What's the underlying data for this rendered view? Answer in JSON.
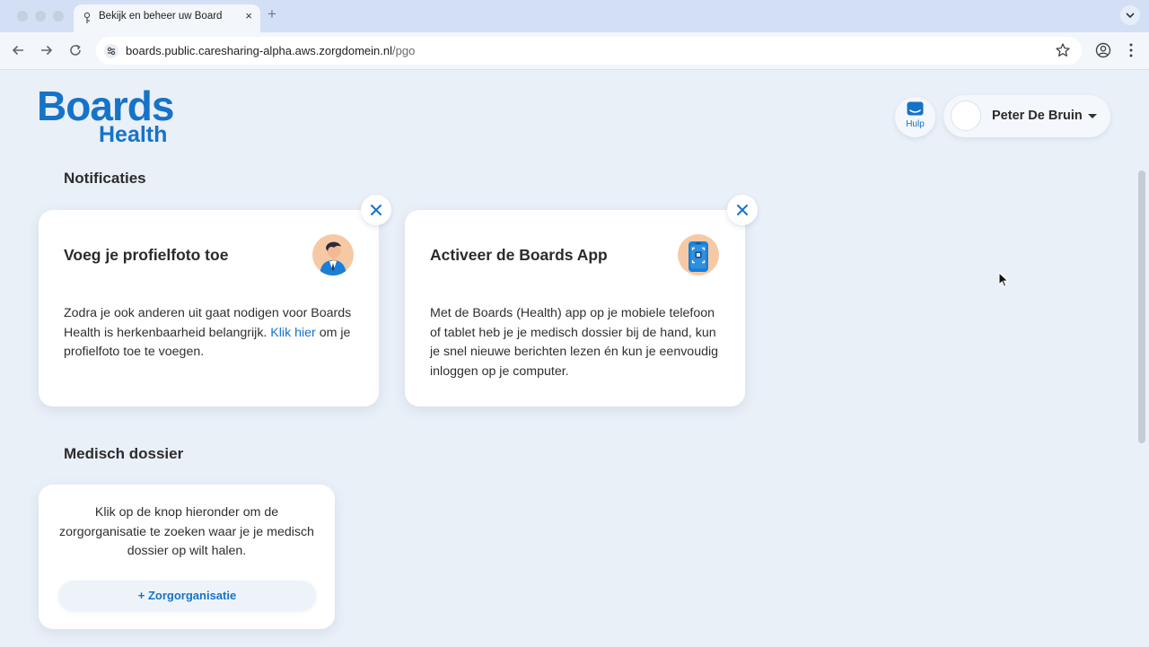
{
  "browser": {
    "tab_title": "Bekijk en beheer uw Boards",
    "tab_close": "×",
    "new_tab": "+",
    "url_host": "boards.public.caresharing-alpha.aws.zorgdomein.nl",
    "url_path": "/pgo"
  },
  "header": {
    "logo_line1": "Boards",
    "logo_line2": "Health",
    "help_label": "Hulp",
    "user_name": "Peter De Bruin"
  },
  "notifications": {
    "title": "Notificaties",
    "cards": [
      {
        "title": "Voeg je profielfoto toe",
        "text_before": "Zodra je ook anderen uit gaat nodigen voor Boards Health is herkenbaarheid belangrijk. ",
        "link": "Klik hier",
        "text_after": " om je profielfoto toe te voegen.",
        "icon": "profile-person-icon"
      },
      {
        "title": "Activeer de Boards App",
        "text": "Met de Boards (Health) app op je mobiele telefoon of tablet heb je je medisch dossier bij de hand, kun je snel nieuwe berichten lezen én kun je eenvoudig inloggen op je computer.",
        "icon": "phone-qr-icon"
      }
    ]
  },
  "dossier": {
    "title": "Medisch dossier",
    "text": "Klik op de knop hieronder om de zorgorganisatie te zoeken waar je je medisch dossier op wilt halen.",
    "button": "+ Zorgorganisatie"
  },
  "colors": {
    "brand": "#1673c8",
    "page_bg": "#eaf0f8",
    "card_bg": "#ffffff",
    "illustration_bg": "#f6c9a5"
  }
}
